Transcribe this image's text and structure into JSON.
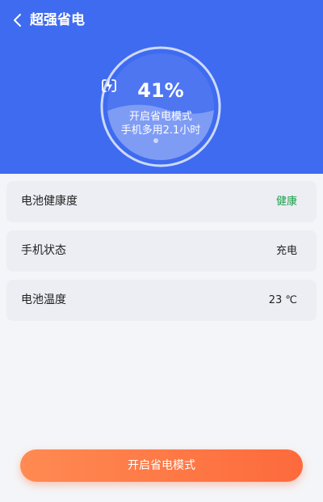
{
  "header": {
    "title": "超强省电",
    "back_icon": "chevron-left-icon",
    "background": "#3f6bf0"
  },
  "battery": {
    "percent": "41%",
    "level": 0.41,
    "mode_text": "开启省电模式",
    "hours_text": "手机多用2.1小时",
    "icon": "battery-charging-icon"
  },
  "status": {
    "items": [
      {
        "label": "电池健康度",
        "value": "健康",
        "value_color": "#1a9f4a"
      },
      {
        "label": "手机状态",
        "value": "充电"
      },
      {
        "label": "电池温度",
        "value": "23 ℃"
      }
    ]
  },
  "action": {
    "label": "开启省电模式",
    "color": "#fd6a3c"
  }
}
